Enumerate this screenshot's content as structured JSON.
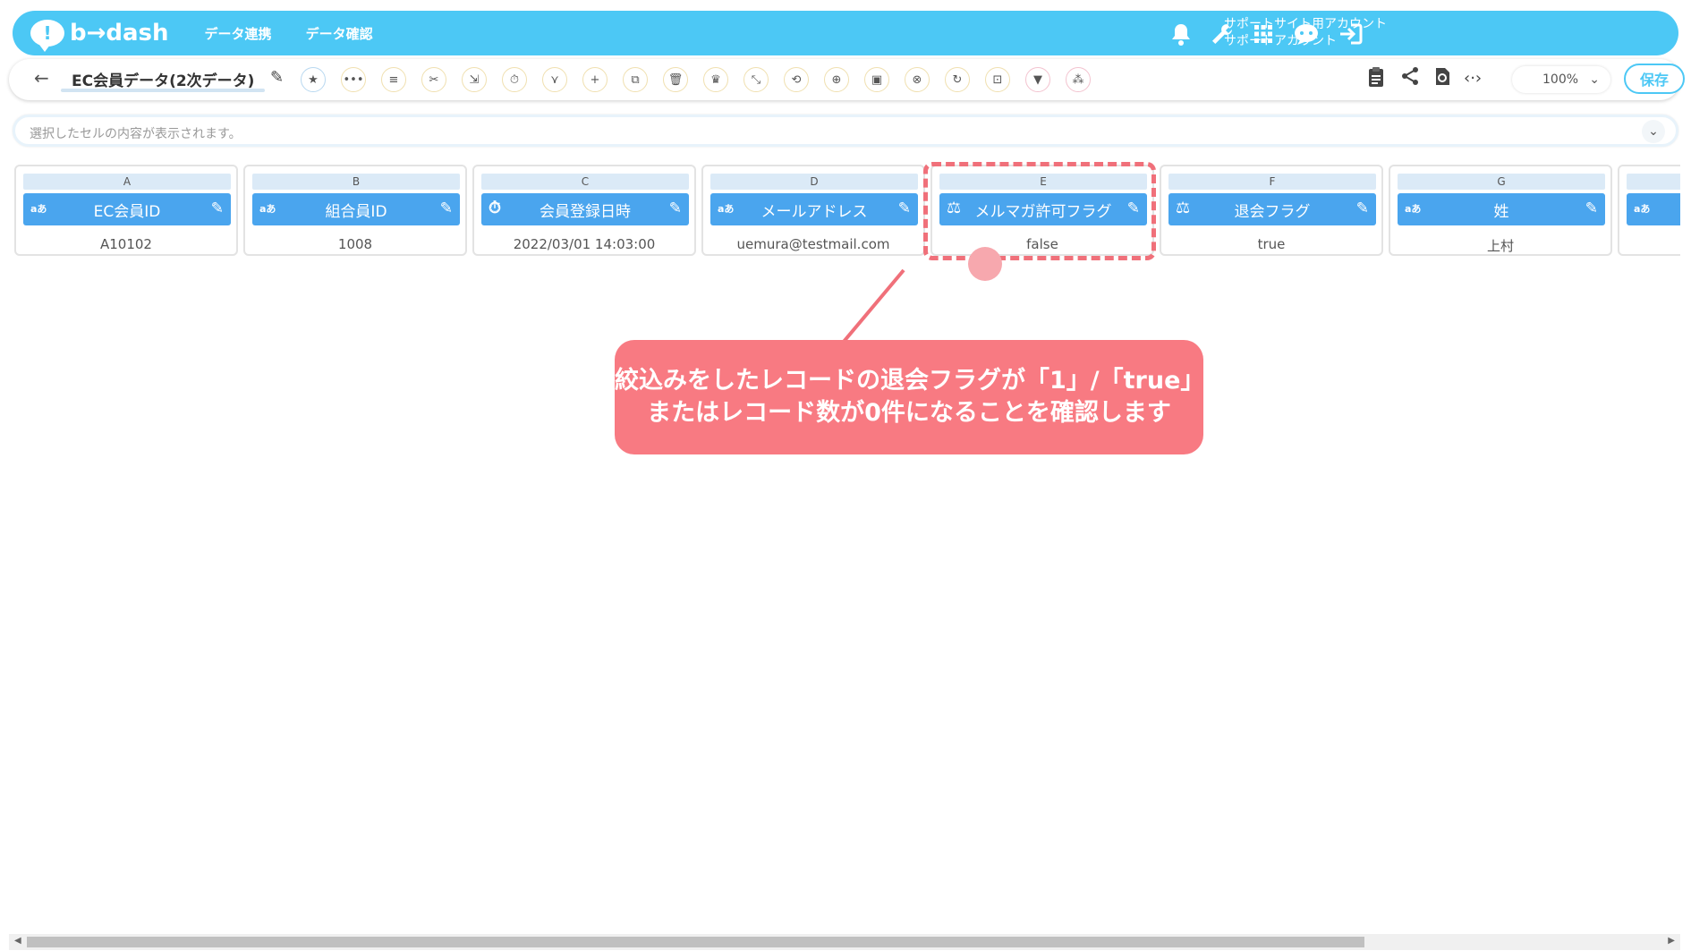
{
  "header": {
    "logo_mark": "!",
    "logo_text": "b→dash",
    "nav": [
      "データ連携",
      "データ確認"
    ],
    "account_line1": "サポートサイト用アカウント",
    "account_line2": "サポートアカウント",
    "icons": [
      "bell-icon",
      "wrench-icon",
      "grid-icon",
      "chat-bot-icon",
      "logout-icon"
    ]
  },
  "toolbar": {
    "back": "←",
    "title": "EC会員データ(2次データ)",
    "title_edit": "✎",
    "tools": [
      {
        "name": "star",
        "glyph": "★"
      },
      {
        "name": "more",
        "glyph": "•••"
      },
      {
        "name": "list",
        "glyph": "≡"
      },
      {
        "name": "scissors",
        "glyph": "✂"
      },
      {
        "name": "expand",
        "glyph": "⇲"
      },
      {
        "name": "timer",
        "glyph": "⏱"
      },
      {
        "name": "merge",
        "glyph": "⋎"
      },
      {
        "name": "add",
        "glyph": "+"
      },
      {
        "name": "copy",
        "glyph": "⧉"
      },
      {
        "name": "trash",
        "glyph": "🗑"
      },
      {
        "name": "crown",
        "glyph": "♛"
      },
      {
        "name": "shrink",
        "glyph": "⤡"
      },
      {
        "name": "repeat",
        "glyph": "⟲"
      },
      {
        "name": "lock-add",
        "glyph": "⊕"
      },
      {
        "name": "box",
        "glyph": "▣"
      },
      {
        "name": "cancel",
        "glyph": "⊗"
      },
      {
        "name": "refresh",
        "glyph": "↻"
      },
      {
        "name": "frame",
        "glyph": "⊡"
      },
      {
        "name": "filter",
        "glyph": "▼"
      },
      {
        "name": "settings",
        "glyph": "⁂"
      }
    ],
    "right_icons": [
      {
        "name": "clipboard-icon",
        "glyph": "📋"
      },
      {
        "name": "share-icon",
        "glyph": "⟨"
      },
      {
        "name": "history-icon",
        "glyph": "⟳"
      },
      {
        "name": "code-icon",
        "glyph": "‹·›"
      }
    ],
    "zoom": "100%",
    "zoom_chevron": "⌄",
    "save": "保存"
  },
  "cellbar": {
    "placeholder": "選択したセルの内容が表示されます。",
    "chevron": "⌄"
  },
  "columns": [
    {
      "letter": "A",
      "header": "EC会員ID",
      "type": "text",
      "type_glyph": "aあ",
      "value": "A10102"
    },
    {
      "letter": "B",
      "header": "組合員ID",
      "type": "text",
      "type_glyph": "aあ",
      "value": "1008"
    },
    {
      "letter": "C",
      "header": "会員登録日時",
      "type": "datetime",
      "type_glyph": "⏱",
      "value": "2022/03/01 14:03:00"
    },
    {
      "letter": "D",
      "header": "メールアドレス",
      "type": "text",
      "type_glyph": "aあ",
      "value": "uemura@testmail.com"
    },
    {
      "letter": "E",
      "header": "メルマガ許可フラグ",
      "type": "flag",
      "type_glyph": "⚖",
      "value": "false"
    },
    {
      "letter": "F",
      "header": "退会フラグ",
      "type": "flag",
      "type_glyph": "⚖",
      "value": "true"
    },
    {
      "letter": "G",
      "header": "姓",
      "type": "text",
      "type_glyph": "aあ",
      "value": "上村"
    },
    {
      "letter": "",
      "header": "",
      "type": "text",
      "type_glyph": "aあ",
      "value": ""
    }
  ],
  "callout": {
    "line1": "絞込みをしたレコードの退会フラグが「1」/「true」",
    "line2": "またはレコード数が0件になることを確認します"
  },
  "colors": {
    "brand": "#4cc8f5",
    "column_header": "#4aa5ee",
    "callout": "#f87a82"
  }
}
